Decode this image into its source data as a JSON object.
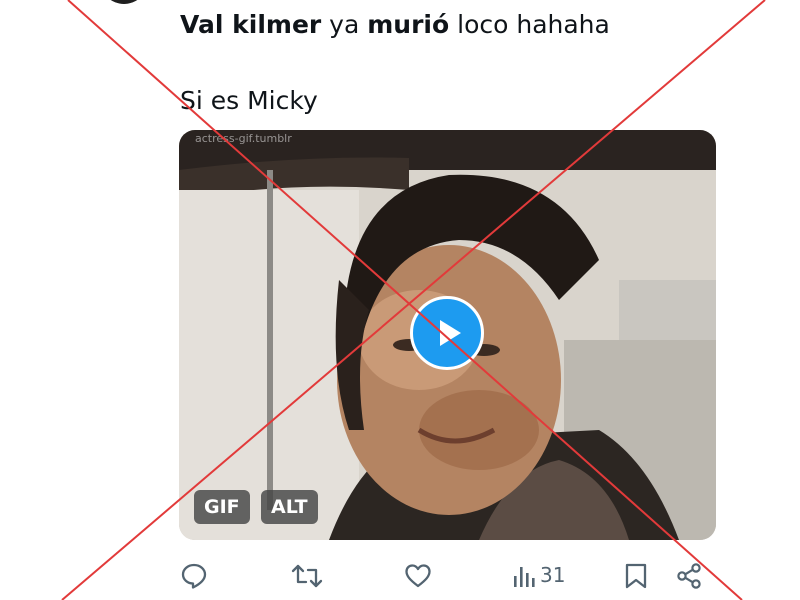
{
  "tweet": {
    "text_line1": {
      "author_name": "Val kilmer",
      "word2": " ya ",
      "word3": "murió",
      "word4": " loco hahaha"
    },
    "text_line2": "Si es Micky"
  },
  "media": {
    "type": "GIF",
    "watermark": "actress-gif.tumblr",
    "badges": {
      "gif": "GIF",
      "alt": "ALT"
    },
    "play_icon": "play-icon"
  },
  "actions": {
    "reply_icon": "reply-icon",
    "retweet_icon": "retweet-icon",
    "like_icon": "heart-icon",
    "views_icon": "views-icon",
    "views_count": "31",
    "bookmark_icon": "bookmark-icon",
    "share_icon": "share-icon"
  },
  "overlay": {
    "cross_color": "#e23a3a"
  },
  "colors": {
    "accent": "#1d9bf0",
    "muted": "#536471"
  }
}
